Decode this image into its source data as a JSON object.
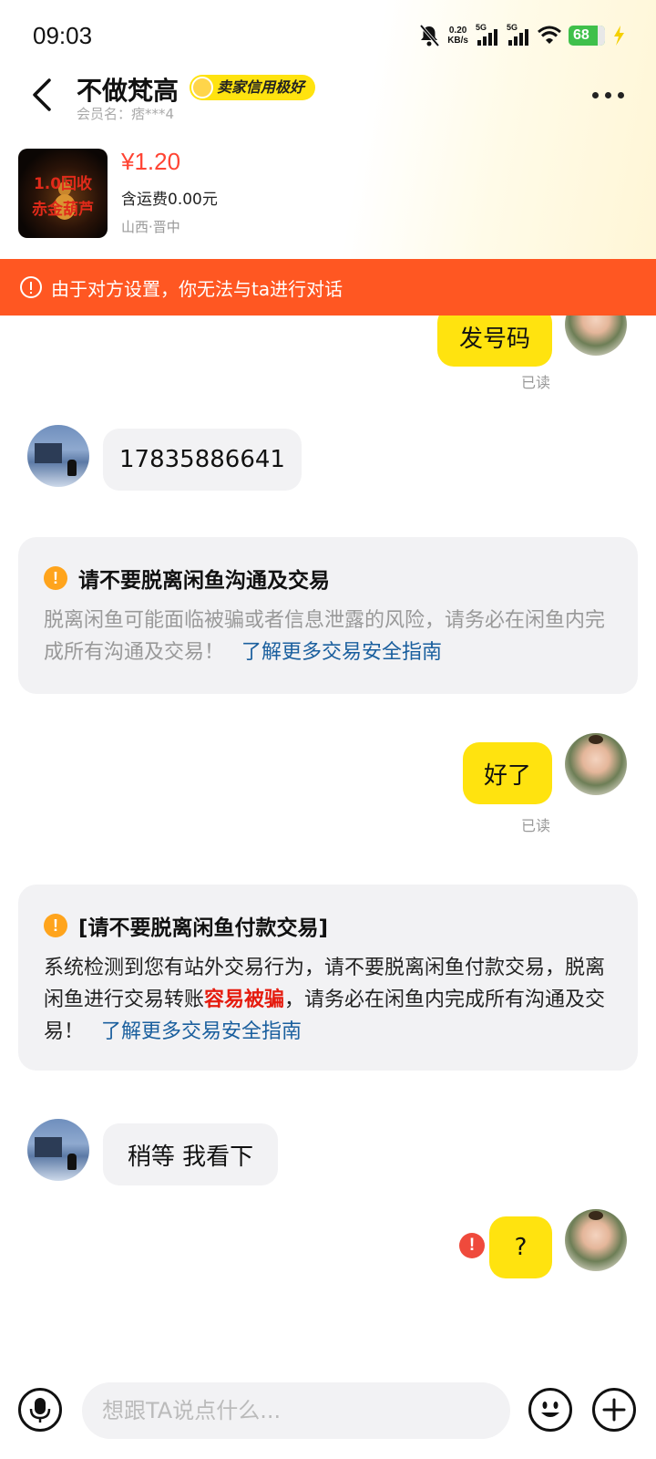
{
  "status_bar": {
    "time": "09:03",
    "net_speed_value": "0.20",
    "net_speed_unit": "KB/s",
    "sim1": "5G",
    "sim2": "5G",
    "battery": "68"
  },
  "header": {
    "seller_name": "不做梵高",
    "credit_badge": "卖家信用极好",
    "member_label": "会员名：痞***4"
  },
  "product": {
    "thumb_line1": "1.0回收",
    "thumb_line2": "赤金葫芦",
    "price": "¥1.20",
    "shipping": "含运费0.00元",
    "location": "山西·晋中"
  },
  "alert": {
    "text": "由于对方设置，你无法与ta进行对话"
  },
  "messages": {
    "m1": "发号码",
    "m1_status": "已读",
    "m2": "17835886641",
    "notice1_title": "请不要脱离闲鱼沟通及交易",
    "notice1_body": "脱离闲鱼可能面临被骗或者信息泄露的风险，请务必在闲鱼内完成所有沟通及交易！",
    "notice1_link": "了解更多交易安全指南",
    "m3": "好了",
    "m3_status": "已读",
    "notice2_title": "[请不要脱离闲鱼付款交易]",
    "notice2_body_a": "系统检测到您有站外交易行为，请不要脱离闲鱼付款交易，脱离闲鱼进行交易转账",
    "notice2_danger": "容易被骗",
    "notice2_body_b": "，请务必在闲鱼内完成所有沟通及交易！",
    "notice2_link": "了解更多交易安全指南",
    "m4": "稍等 我看下",
    "m5": "?",
    "m5_fail": "!"
  },
  "input": {
    "placeholder": "想跟TA说点什么..."
  },
  "colors": {
    "accent_yellow": "#ffe30f",
    "alert_orange": "#ff5722",
    "price_red": "#ff4433",
    "link_blue": "#1a5f9e",
    "warn_orange": "#ffa41c"
  }
}
